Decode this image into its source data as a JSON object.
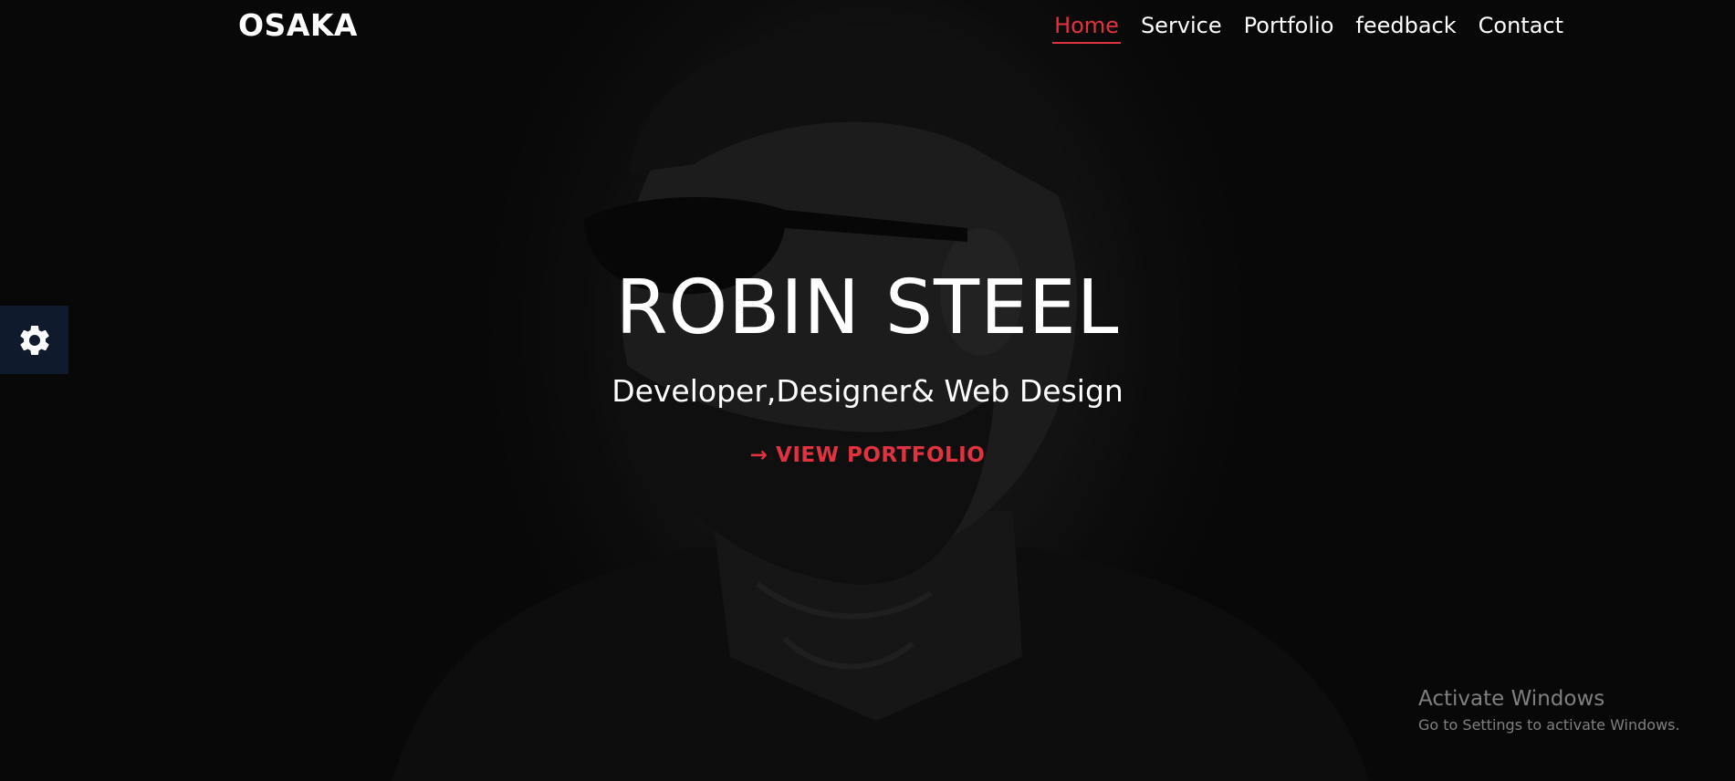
{
  "brand": "OSAKA",
  "nav": {
    "items": [
      {
        "label": "Home",
        "active": true
      },
      {
        "label": "Service",
        "active": false
      },
      {
        "label": "Portfolio",
        "active": false
      },
      {
        "label": "feedback",
        "active": false
      },
      {
        "label": "Contact",
        "active": false
      }
    ]
  },
  "hero": {
    "title": "ROBIN STEEL",
    "subtitle": "Developer,Designer& Web Design",
    "cta_icon": "arrow-right-icon",
    "cta_label": "VIEW PORTFOLIO"
  },
  "settings": {
    "icon": "gear-icon"
  },
  "watermark": {
    "title": "Activate Windows",
    "subtitle": "Go to Settings to activate Windows."
  },
  "colors": {
    "accent": "#e0323f",
    "text": "#ffffff",
    "settings_bg": "#0f1a2c",
    "background": "#0c0c0c"
  }
}
